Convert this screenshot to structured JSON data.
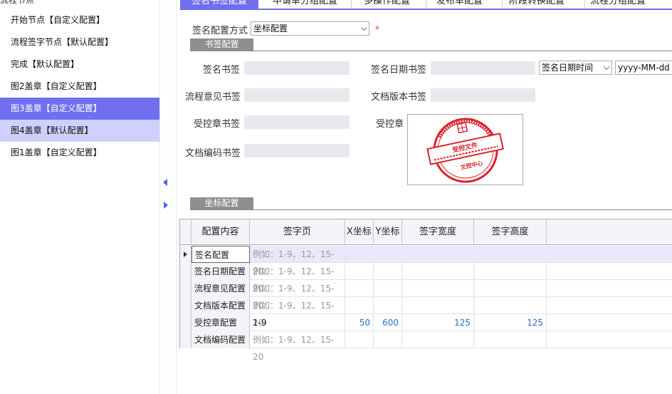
{
  "sidebar": {
    "cut_label": "流程节点",
    "items": [
      {
        "label": "开始节点【自定义配置】",
        "state": "normal"
      },
      {
        "label": "流程签字节点【默认配置】",
        "state": "normal"
      },
      {
        "label": "完成【默认配置】",
        "state": "normal"
      },
      {
        "label": "图2盖章【自定义配置】",
        "state": "normal"
      },
      {
        "label": "图3盖章【自定义配置】",
        "state": "active"
      },
      {
        "label": "图4盖章【默认配置】",
        "state": "hover"
      },
      {
        "label": "图1盖章【自定义配置】",
        "state": "normal"
      }
    ]
  },
  "tabs": [
    {
      "label": "签名书签配置",
      "active": true
    },
    {
      "label": "申请单分组配置",
      "active": false
    },
    {
      "label": "多操作配置",
      "active": false
    },
    {
      "label": "发布单配置",
      "active": false
    },
    {
      "label": "阶段转换配置",
      "active": false
    },
    {
      "label": "流程分组配置",
      "active": false
    }
  ],
  "config_mode": {
    "label": "签名配置方式",
    "value": "坐标配置",
    "required_mark": "*"
  },
  "bookmark_section": {
    "title": "书签配置",
    "fields": {
      "sign_bookmark": "签名书签",
      "sign_date_bookmark": "签名日期书签",
      "flow_opinion_bookmark": "流程意见书签",
      "doc_version_bookmark": "文档版本书签",
      "controlled_seal_bookmark": "受控章书签",
      "controlled_seal": "受控章",
      "doc_code_bookmark": "文档编码书签"
    },
    "date_type_value": "签名日期时间",
    "date_format_value": "yyyy-MM-dd HH"
  },
  "seal": {
    "main_text": "受控文件",
    "sub_text": "文控中心"
  },
  "coord_section": {
    "title": "坐标配置"
  },
  "grid": {
    "columns": [
      "配置内容",
      "签字页",
      "X坐标",
      "Y坐标",
      "签字宽度",
      "签字高度"
    ],
    "placeholder": "例如：1-9、12、15-20",
    "rows": [
      {
        "name": "签名配置",
        "page": "",
        "x": "",
        "y": "",
        "w": "",
        "h": ""
      },
      {
        "name": "签名日期配置",
        "page": "",
        "x": "",
        "y": "",
        "w": "",
        "h": ""
      },
      {
        "name": "流程意见配置",
        "page": "",
        "x": "",
        "y": "",
        "w": "",
        "h": ""
      },
      {
        "name": "文档版本配置",
        "page": "",
        "x": "",
        "y": "",
        "w": "",
        "h": ""
      },
      {
        "name": "受控章配置",
        "page": "1-9",
        "x": "50",
        "y": "600",
        "w": "125",
        "h": "125"
      },
      {
        "name": "文档编码配置",
        "page": "",
        "x": "",
        "y": "",
        "w": "",
        "h": ""
      }
    ]
  },
  "colors": {
    "accent": "#6f6ff0",
    "seal_red": "#d9242b",
    "link_blue": "#2a6cc8"
  }
}
